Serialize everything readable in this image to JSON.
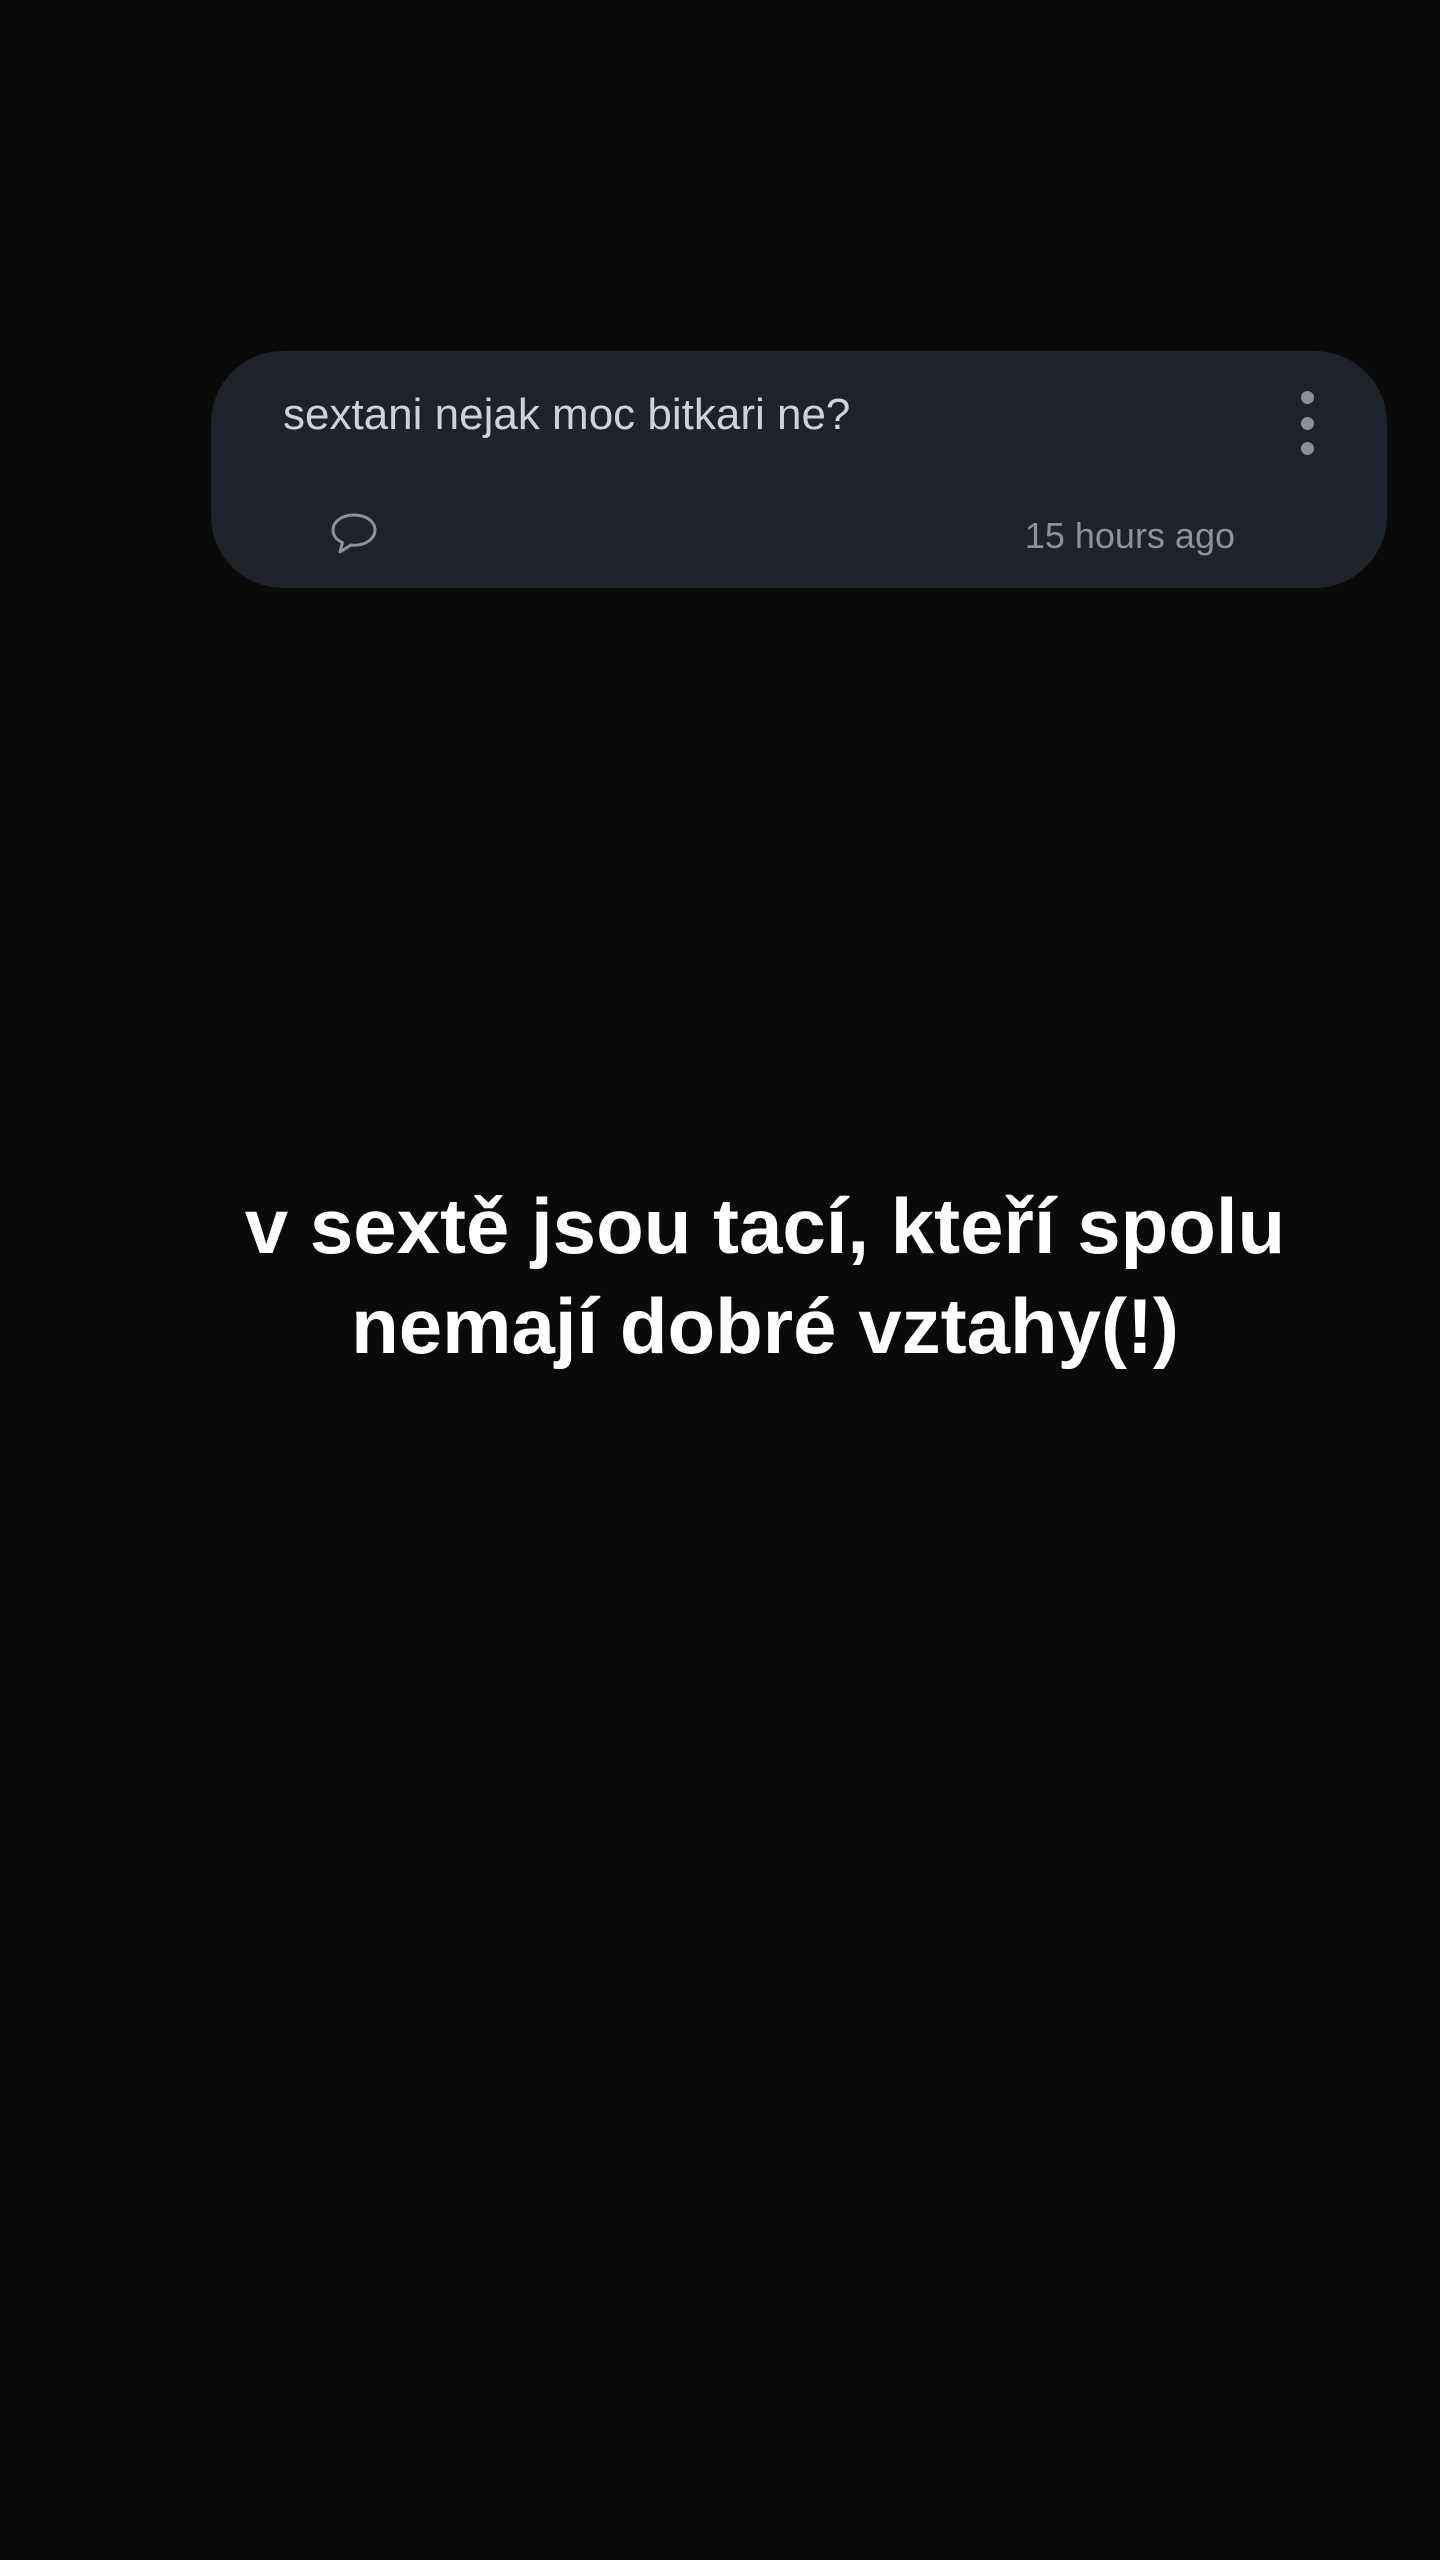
{
  "post": {
    "question": "sextani nejak moc bitkari ne?",
    "timestamp": "15 hours ago",
    "comment_icon": "speech-bubble-icon",
    "menu_icon": "more-vertical-icon"
  },
  "overlay": {
    "line1": "v sextě jsou tací, kteří spolu",
    "line2": "nemají dobré vztahy(!)"
  },
  "colors": {
    "background": "#0a0a0b",
    "card": "#1d222b",
    "question_text": "#cfd2d7",
    "muted": "#8e929a",
    "overlay_text": "#ffffff"
  }
}
